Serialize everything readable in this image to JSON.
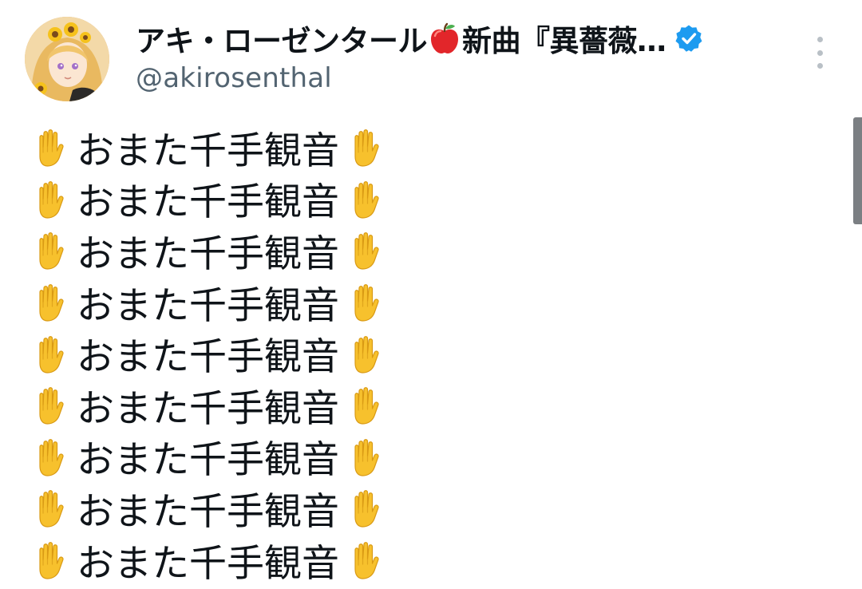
{
  "tweet": {
    "author": {
      "display_name": "アキ・ローゼンタール",
      "display_name_emoji": "apple-icon",
      "display_name_suffix": "新曲『異薔薇…",
      "verified": true,
      "verified_color": "#1d9bf0",
      "handle": "@akirosenthal",
      "avatar": "avatar-icon"
    },
    "more_menu_icon": "more-vertical-icon",
    "body_lines": [
      {
        "lead_icon": "raised-hand-icon",
        "text": "おまた千手観音",
        "trail_icon": "raised-hand-icon"
      },
      {
        "lead_icon": "raised-hand-icon",
        "text": "おまた千手観音",
        "trail_icon": "raised-hand-icon"
      },
      {
        "lead_icon": "raised-hand-icon",
        "text": "おまた千手観音",
        "trail_icon": "raised-hand-icon"
      },
      {
        "lead_icon": "raised-hand-icon",
        "text": "おまた千手観音",
        "trail_icon": "raised-hand-icon"
      },
      {
        "lead_icon": "raised-hand-icon",
        "text": "おまた千手観音",
        "trail_icon": "raised-hand-icon"
      },
      {
        "lead_icon": "raised-hand-icon",
        "text": "おまた千手観音",
        "trail_icon": "raised-hand-icon"
      },
      {
        "lead_icon": "raised-hand-icon",
        "text": "おまた千手観音",
        "trail_icon": "raised-hand-icon"
      },
      {
        "lead_icon": "raised-hand-icon",
        "text": "おまた千手観音",
        "trail_icon": "raised-hand-icon"
      },
      {
        "lead_icon": "raised-hand-icon",
        "text": "おまた千手観音",
        "trail_icon": "raised-hand-icon"
      }
    ]
  },
  "colors": {
    "text_primary": "#0f1419",
    "text_secondary": "#536471",
    "hand_emoji": "#f7c12d",
    "apple_emoji": "#e2262a",
    "scrollbar": "#7b7f83"
  }
}
